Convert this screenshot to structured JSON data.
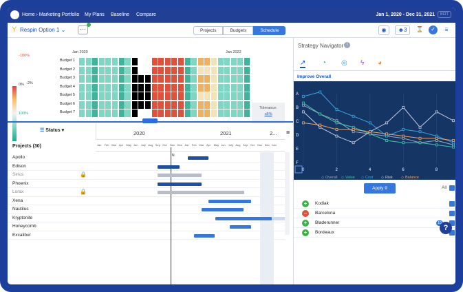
{
  "topbar": {
    "breadcrumb": "Home › Marketing Portfolio",
    "nav": [
      "My Plans",
      "Baseline",
      "Compare"
    ],
    "date_range": "Jan 1, 2020 - Dec 31, 2021",
    "tz": "EDT"
  },
  "toolbar": {
    "option_name": "Respin Option 1",
    "more": "···",
    "tabs": [
      "Projects",
      "Budgets",
      "Schedule"
    ],
    "active_tab": "Schedule",
    "team_count": "3"
  },
  "heatmap": {
    "start_label": "Jan 2020",
    "end_label": "Jan 2022",
    "budgets": [
      "Budget 1",
      "Budget 2",
      "Budget 3",
      "Budget 4",
      "Budget 5",
      "Budget 6",
      "Budget 7"
    ],
    "legend": [
      "-100%",
      "0%",
      "-2%",
      "100%"
    ],
    "tolerance_label": "Tolerance:",
    "tolerance_value": "≤5%",
    "colors": {
      "teal": "#7fd6c2",
      "dark_teal": "#3fb49a",
      "black": "#000000",
      "red": "#e0503a",
      "orange": "#f0b060",
      "cream": "#f2e3b8",
      "white": "#ffffff"
    }
  },
  "gantt": {
    "status_label": "Status",
    "projects_header": "Projects (30)",
    "years": [
      "2020",
      "2021",
      "2..."
    ],
    "months": [
      "Jan",
      "Feb",
      "Mar",
      "Apr",
      "May",
      "Jun",
      "July",
      "Aug",
      "Sep",
      "Oct",
      "Nov",
      "Dec",
      "Jan",
      "Feb",
      "Mar",
      "Apr",
      "May",
      "Jun",
      "July",
      "Aug",
      "Sep",
      "Oct",
      "Nov",
      "Dec",
      "Jan"
    ],
    "today_label": "N",
    "projects": [
      {
        "name": "Apollo",
        "locked": false,
        "muted": false
      },
      {
        "name": "Edison",
        "locked": false,
        "muted": false
      },
      {
        "name": "Sirius",
        "locked": true,
        "muted": true
      },
      {
        "name": "Phoenix",
        "locked": false,
        "muted": false
      },
      {
        "name": "Lorax",
        "locked": true,
        "muted": true
      },
      {
        "name": "Xena",
        "locked": false,
        "muted": false
      },
      {
        "name": "Nautilus",
        "locked": false,
        "muted": false
      },
      {
        "name": "Kryptonite",
        "locked": false,
        "muted": false
      },
      {
        "name": "Honeycomb",
        "locked": false,
        "muted": false
      },
      {
        "name": "Excalibur",
        "locked": false,
        "muted": false
      }
    ]
  },
  "strategy": {
    "title": "Strategy Navigator",
    "subtitle": "Improve Overall",
    "apply_label": "Apply 9",
    "all_label": "All",
    "help_badge": "10",
    "cities": [
      {
        "name": "Kodiak",
        "type": "add"
      },
      {
        "name": "Barcelona",
        "type": "remove"
      },
      {
        "name": "Bladerunner",
        "type": "add"
      },
      {
        "name": "Bordeaux",
        "type": "add"
      }
    ]
  },
  "chart_data": {
    "type": "line",
    "y_categories": [
      "A",
      "B",
      "C",
      "D",
      "E",
      "F"
    ],
    "x_ticks": [
      0,
      2,
      4,
      6,
      8
    ],
    "xlim": [
      0,
      9
    ],
    "series": [
      {
        "name": "Overall",
        "color": "#9aa6c0",
        "values": [
          2.6,
          2.2,
          1.9,
          1.4,
          1.3,
          1.2,
          1.1,
          0.9,
          1.0,
          0.8
        ]
      },
      {
        "name": "Value",
        "color": "#3fc6a8",
        "values": [
          2.7,
          2.2,
          1.8,
          1.6,
          1.3,
          1.0,
          0.9,
          0.9,
          0.8,
          0.7
        ]
      },
      {
        "name": "Cost",
        "color": "#35a7e0",
        "values": [
          3.0,
          3.2,
          2.4,
          2.1,
          1.8,
          1.2,
          1.5,
          1.4,
          1.2,
          0.9
        ]
      },
      {
        "name": "Risk",
        "color": "#c8ccde",
        "values": [
          2.3,
          1.6,
          1.2,
          0.9,
          1.4,
          1.8,
          2.5,
          1.6,
          2.3,
          1.9
        ]
      },
      {
        "name": "Balance",
        "color": "#f0a35a",
        "values": [
          1.8,
          1.7,
          1.5,
          1.5,
          1.4,
          1.3,
          1.2,
          1.1,
          1.1,
          1.0
        ]
      }
    ]
  }
}
